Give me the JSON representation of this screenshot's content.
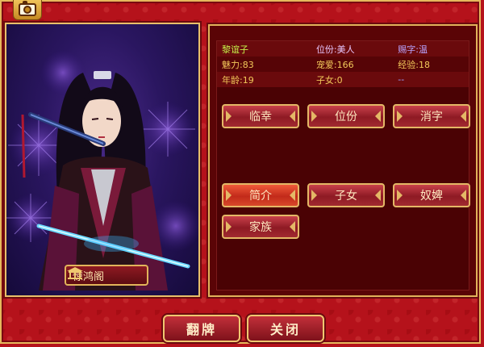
{
  "icons": {
    "camera": "camera-icon",
    "location": "pavilion-icon"
  },
  "colors": {
    "background": "#b5121b",
    "gold_border": "#e0b25a",
    "stat_text": "#f2c85a",
    "name_text": "#c4f04a"
  },
  "portrait": {
    "location_label": "惊鸿阁"
  },
  "stats": {
    "rows": [
      {
        "c1": "黎谊子",
        "c2": "位份:美人",
        "c3": "赐字:温"
      },
      {
        "c1": "魅力:83",
        "c2": "宠爱:166",
        "c3": "经验:18"
      },
      {
        "c1": "年龄:19",
        "c2": "子女:0",
        "c3": "--"
      }
    ]
  },
  "actions": {
    "row1": [
      "临幸",
      "位份",
      "消字"
    ],
    "row2": [
      "简介",
      "子女",
      "奴婢"
    ],
    "row3": [
      "家族"
    ]
  },
  "footer": {
    "flip_label": "翻牌",
    "close_label": "关闭"
  }
}
